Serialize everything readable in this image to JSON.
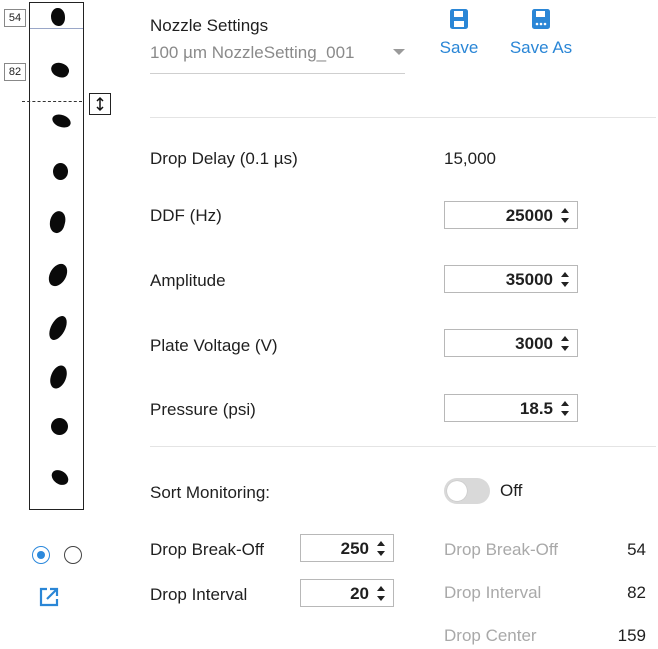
{
  "strip": {
    "marker_top": "54",
    "marker_mid": "82"
  },
  "header": {
    "title": "Nozzle Settings",
    "preset": "100 µm NozzleSetting_001",
    "save_label": "Save",
    "save_as_label": "Save As"
  },
  "params": {
    "drop_delay": {
      "label": "Drop Delay (0.1 µs)",
      "value": "15,000"
    },
    "ddf": {
      "label": "DDF (Hz)",
      "value": "25000"
    },
    "amplitude": {
      "label": "Amplitude",
      "value": "35000"
    },
    "plate_voltage": {
      "label": "Plate Voltage (V)",
      "value": "3000"
    },
    "pressure": {
      "label": "Pressure (psi)",
      "value": "18.5"
    }
  },
  "sort_monitoring": {
    "label": "Sort Monitoring:",
    "state": "Off",
    "break_off": {
      "label": "Drop Break-Off",
      "value": "250"
    },
    "interval": {
      "label": "Drop Interval",
      "value": "20"
    }
  },
  "monitor": {
    "break_off": {
      "label": "Drop Break-Off",
      "value": "54"
    },
    "interval": {
      "label": "Drop Interval",
      "value": "82"
    },
    "center": {
      "label": "Drop Center",
      "value": "159"
    }
  },
  "colors": {
    "accent": "#2a86d6"
  },
  "icons": {
    "save": "floppy-disk-icon",
    "save_as": "floppy-disk-dots-icon",
    "resize": "vertical-resize-icon",
    "popout": "open-external-icon"
  }
}
